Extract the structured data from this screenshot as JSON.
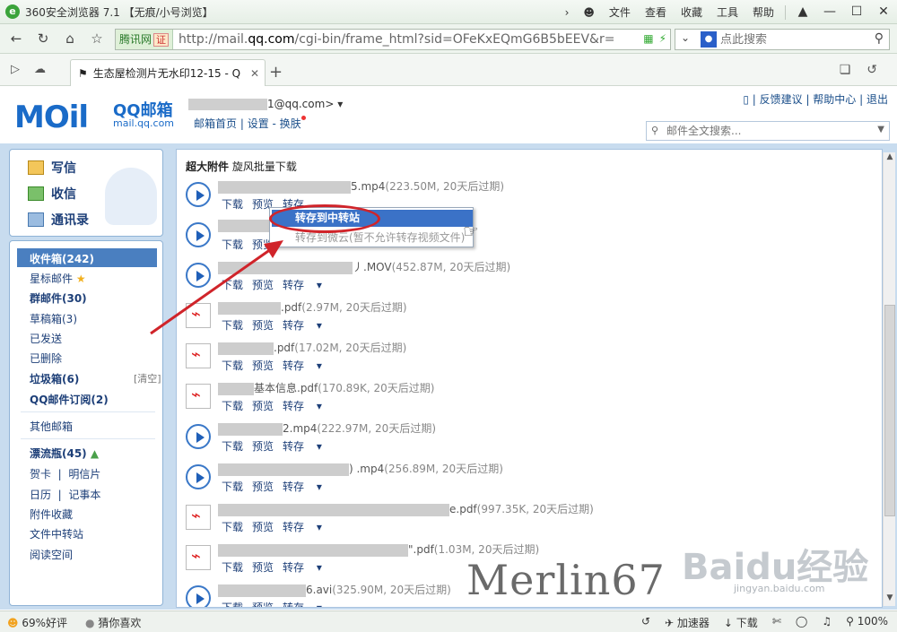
{
  "browser": {
    "title": "360安全浏览器 7.1 【无痕/小号浏览】",
    "menu": [
      "文件",
      "查看",
      "收藏",
      "工具",
      "帮助"
    ],
    "cert_label": "腾讯网",
    "cert_badge": "证",
    "url_prefix": "http://mail.",
    "url_domain": "qq.com",
    "url_rest": "/cgi-bin/frame_html?sid=OFeKxEQmG6B5bEEV&r=",
    "search_placeholder": "点此搜索",
    "tab_label": "生态屋检测片无水印12-15 - Q",
    "zoom": "100%"
  },
  "mail": {
    "logo": "MOil",
    "brand": "QQ邮箱",
    "brand_sub": "mail.qq.com",
    "account_suffix": "1@qq.com>",
    "links": [
      "邮箱首页",
      "设置",
      "换肤"
    ],
    "top_links": [
      "反馈建议",
      "帮助中心",
      "退出"
    ],
    "search_placeholder": "邮件全文搜索..."
  },
  "sidebar": {
    "compose": "写信",
    "receive": "收信",
    "contacts": "通讯录",
    "inbox": "收件箱(242)",
    "starred": "星标邮件",
    "group": "群邮件(30)",
    "drafts": "草稿箱(3)",
    "sent": "已发送",
    "deleted": "已删除",
    "junk": "垃圾箱(6)",
    "clear": "[清空]",
    "subscription": "QQ邮件订阅(2)",
    "other": "其他邮箱",
    "bottle": "漂流瓶(45)",
    "card": "贺卡",
    "postcard": "明信片",
    "calendar": "日历",
    "notes": "记事本",
    "attachments": "附件收藏",
    "transfer": "文件中转站",
    "reading": "阅读空间"
  },
  "content": {
    "crumb_title": "超大附件",
    "crumb_link": "旋风批量下载",
    "actions": {
      "download": "下载",
      "preview": "预览",
      "save": "转存"
    },
    "attachments": [
      {
        "type": "video",
        "name_suffix": "5.mp4",
        "meta": "(223.50M, 20天后过期)"
      },
      {
        "type": "video",
        "name_suffix": "",
        "meta": ""
      },
      {
        "type": "video",
        "name_suffix": "丿.MOV",
        "meta": "(452.87M, 20天后过期)"
      },
      {
        "type": "pdf",
        "name_suffix": ".pdf",
        "meta": "(2.97M, 20天后过期)"
      },
      {
        "type": "pdf",
        "name_suffix": ".pdf",
        "meta": "(17.02M, 20天后过期)"
      },
      {
        "type": "pdf",
        "name_suffix": "基本信息.pdf",
        "meta": "(170.89K, 20天后过期)"
      },
      {
        "type": "video",
        "name_suffix": "2.mp4",
        "meta": "(222.97M, 20天后过期)"
      },
      {
        "type": "video",
        "name_suffix": ") .mp4",
        "meta": "(256.89M, 20天后过期)"
      },
      {
        "type": "pdf",
        "name_suffix": "e.pdf",
        "meta": "(997.35K, 20天后过期)"
      },
      {
        "type": "pdf",
        "name_suffix": "\".pdf",
        "meta": "(1.03M, 20天后过期)"
      },
      {
        "type": "video",
        "name_suffix": "6.avi",
        "meta": "(325.90M, 20天后过期)"
      }
    ],
    "context_menu": {
      "item1": "转存到中转站",
      "item2": "转存到微云(暂不允许转存视频文件)"
    }
  },
  "statusbar": {
    "rating": "69%好评",
    "guess": "猜你喜欢",
    "accelerator": "加速器",
    "download": "下载",
    "zoom": "100%"
  },
  "watermark": {
    "author": "Merlin67",
    "baidu": "Baidu经验",
    "baidu_sub": "jingyan.baidu.com"
  },
  "colors": {
    "accent": "#1a6bc8",
    "frame": "#c8dcef",
    "highlight": "#d0242a"
  }
}
